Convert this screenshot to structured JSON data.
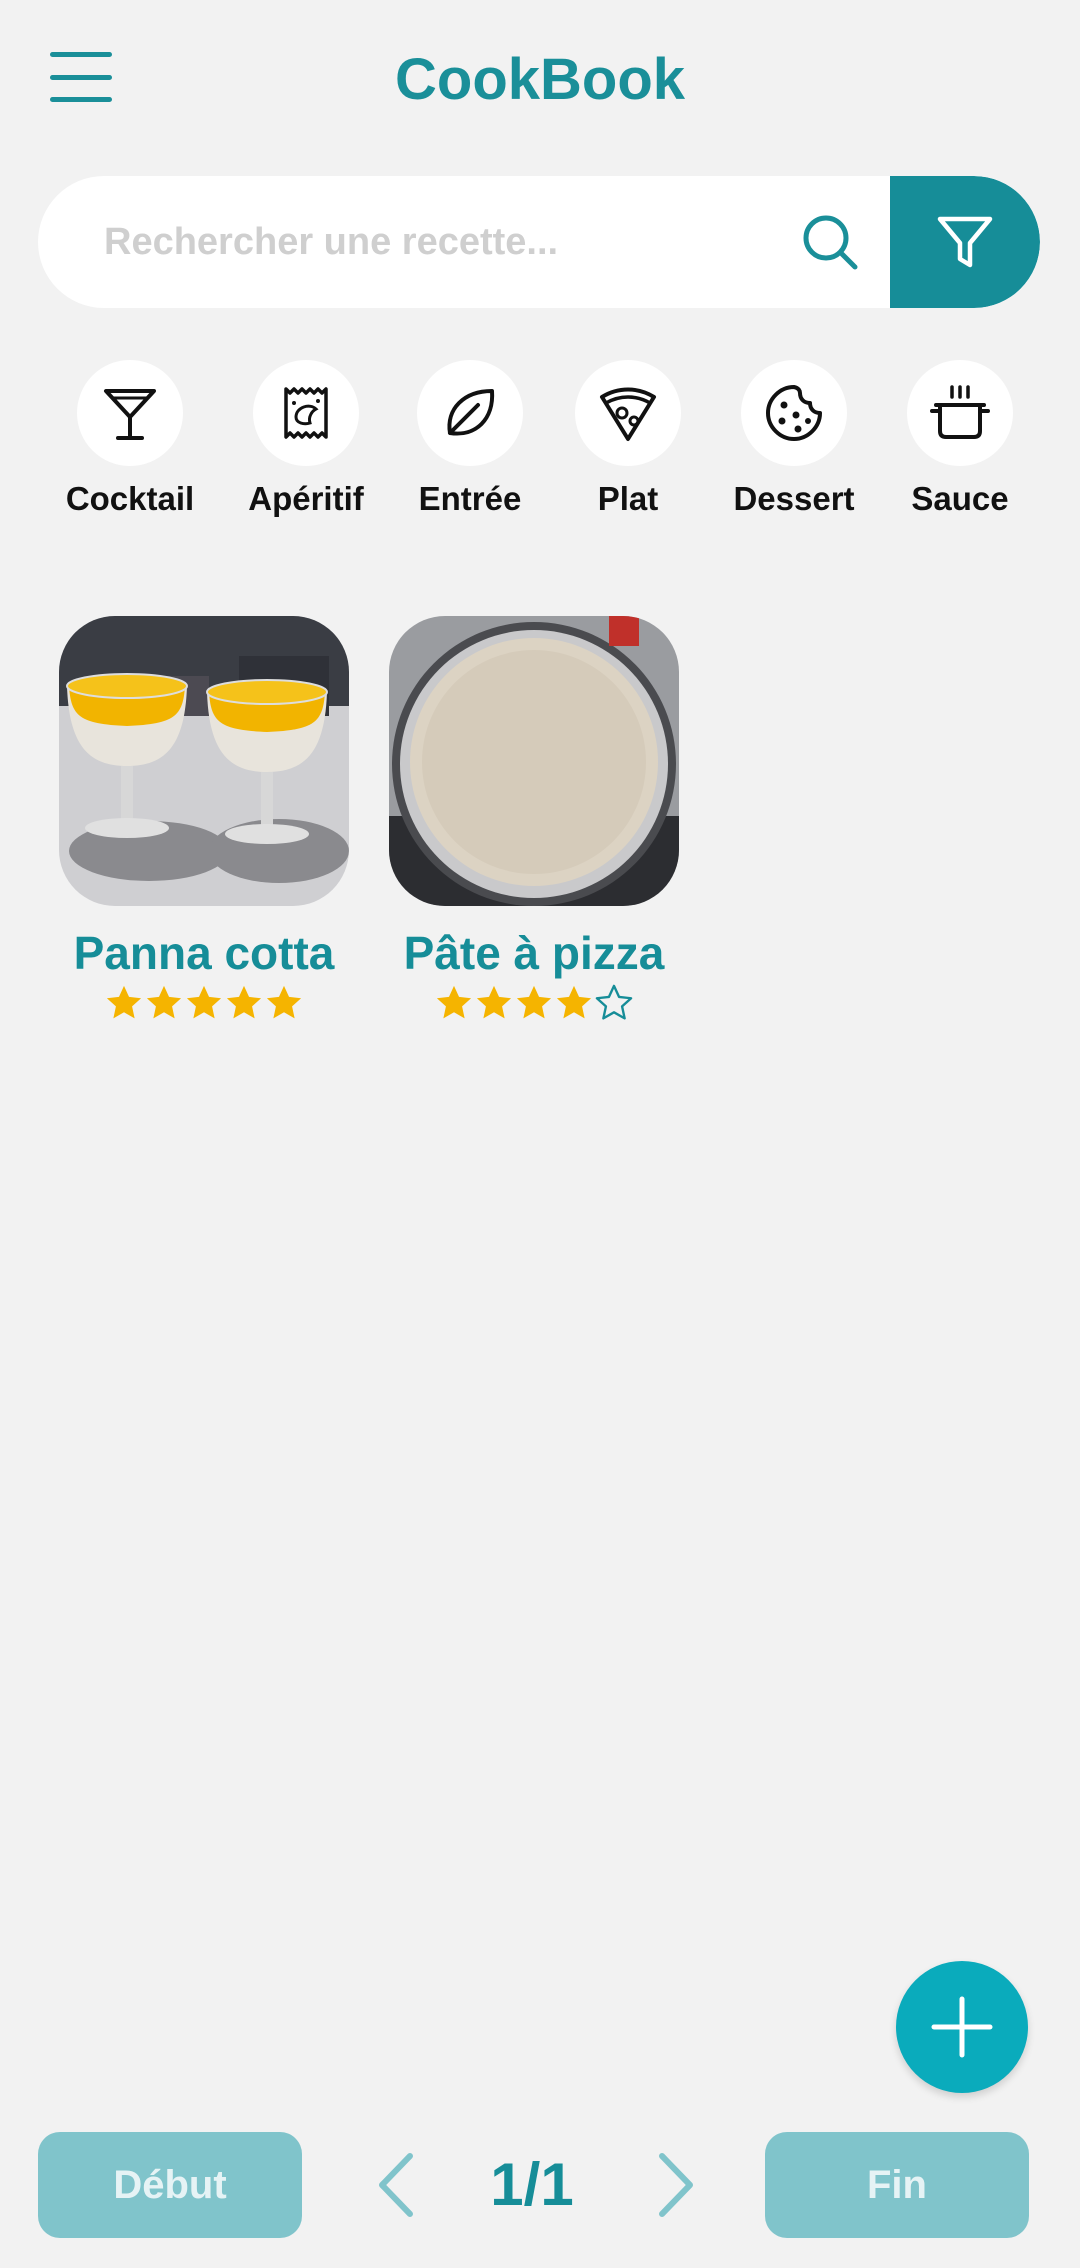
{
  "header": {
    "title": "CookBook",
    "menu_icon": "hamburger-menu-icon"
  },
  "search": {
    "placeholder": "Rechercher une recette...",
    "value": "",
    "search_icon": "search-icon",
    "filter_icon": "filter-icon"
  },
  "categories": [
    {
      "label": "Cocktail",
      "icon": "cocktail-glass-icon"
    },
    {
      "label": "Apéritif",
      "icon": "chips-bag-icon"
    },
    {
      "label": "Entrée",
      "icon": "leaf-icon"
    },
    {
      "label": "Plat",
      "icon": "pizza-slice-icon"
    },
    {
      "label": "Dessert",
      "icon": "cookie-icon"
    },
    {
      "label": "Sauce",
      "icon": "cooking-pot-icon"
    }
  ],
  "recipes": [
    {
      "name": "Panna cotta",
      "rating": 5,
      "max_rating": 5
    },
    {
      "name": "Pâte à pizza",
      "rating": 4,
      "max_rating": 5
    }
  ],
  "fab": {
    "icon": "plus-icon"
  },
  "pagination": {
    "first_label": "Début",
    "last_label": "Fin",
    "page_text": "1/1",
    "prev_icon": "chevron-left-icon",
    "next_icon": "chevron-right-icon"
  },
  "colors": {
    "accent": "#168d98",
    "fab": "#0aabbc",
    "star": "#f5b400",
    "background": "#f2f2f2"
  }
}
